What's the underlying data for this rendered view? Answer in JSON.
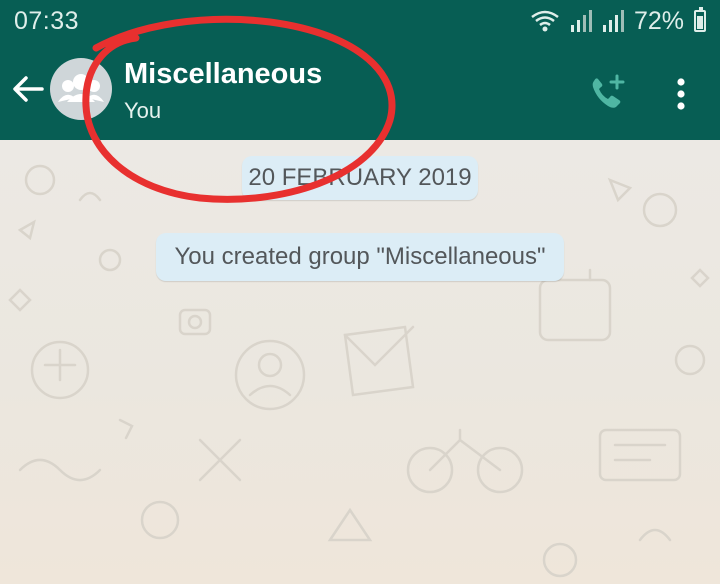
{
  "status_bar": {
    "time": "07:33",
    "battery": "72%",
    "icons": [
      "wifi-icon",
      "signal-icon",
      "signal-icon",
      "battery-icon"
    ]
  },
  "header": {
    "back_icon": "arrow-left-icon",
    "avatar_icon": "group-icon",
    "title": "Miscellaneous",
    "subtitle": "You",
    "call_icon": "add-call-icon",
    "menu_icon": "more-vert-icon"
  },
  "chat": {
    "date_divider": "20 FEBRUARY 2019",
    "system_message": "You created group \"Miscellaneous\""
  },
  "colors": {
    "header_bg": "#075e54",
    "bubble_bg": "#dcedf6",
    "annotation": "#e8302f"
  }
}
